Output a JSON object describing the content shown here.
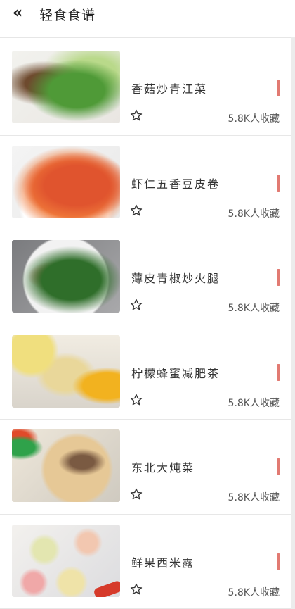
{
  "header": {
    "title": "轻食食谱"
  },
  "recipes": [
    {
      "name": "香菇炒青江菜",
      "favorites": "5.8K人收藏"
    },
    {
      "name": "虾仁五香豆皮卷",
      "favorites": "5.8K人收藏"
    },
    {
      "name": "薄皮青椒炒火腿",
      "favorites": "5.8K人收藏"
    },
    {
      "name": "柠檬蜂蜜减肥茶",
      "favorites": "5.8K人收藏"
    },
    {
      "name": "东北大炖菜",
      "favorites": "5.8K人收藏"
    },
    {
      "name": "鲜果西米露",
      "favorites": "5.8K人收藏"
    }
  ],
  "icons": {
    "back": "double-chevron-left-icon",
    "favorite": "star-outline-icon"
  },
  "colors": {
    "accent": "#e27a72",
    "divider": "#e7e7e7",
    "text": "#333333"
  }
}
